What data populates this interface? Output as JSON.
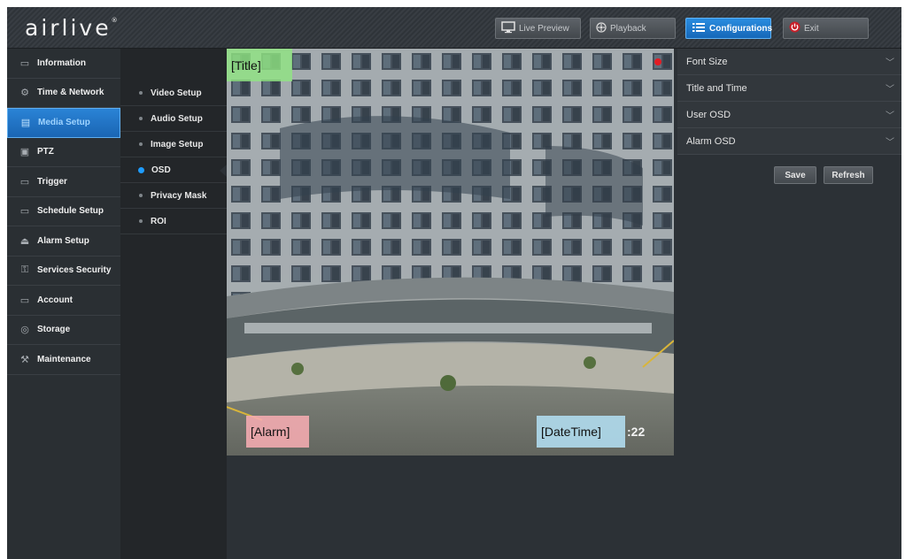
{
  "brand": {
    "logo_text": "airlive",
    "logo_mark": "®"
  },
  "header": {
    "buttons": [
      {
        "label": "Live Preview",
        "icon": "monitor-icon"
      },
      {
        "label": "Playback",
        "icon": "playback-icon"
      },
      {
        "label": "Configurations",
        "icon": "list-icon",
        "active": true
      },
      {
        "label": "Exit",
        "icon": "power-icon"
      }
    ]
  },
  "sidebar": {
    "items": [
      {
        "label": "Information",
        "icon": "info-icon"
      },
      {
        "label": "Time & Network",
        "icon": "gear-icon"
      },
      {
        "label": "Media Setup",
        "icon": "media-icon",
        "active": true
      },
      {
        "label": "PTZ",
        "icon": "ptz-icon"
      },
      {
        "label": "Trigger",
        "icon": "trigger-icon"
      },
      {
        "label": "Schedule Setup",
        "icon": "schedule-icon"
      },
      {
        "label": "Alarm Setup",
        "icon": "alarm-icon"
      },
      {
        "label": "Services Security",
        "icon": "security-icon"
      },
      {
        "label": "Account",
        "icon": "account-icon"
      },
      {
        "label": "Storage",
        "icon": "storage-icon"
      },
      {
        "label": "Maintenance",
        "icon": "wrench-icon"
      }
    ]
  },
  "subnav": {
    "items": [
      {
        "label": "Video Setup"
      },
      {
        "label": "Audio Setup"
      },
      {
        "label": "Image Setup"
      },
      {
        "label": "OSD",
        "active": true
      },
      {
        "label": "Privacy Mask"
      },
      {
        "label": "ROI"
      }
    ]
  },
  "preview": {
    "osd_title": "[Title]",
    "osd_alarm": "[Alarm]",
    "osd_datetime": "[DateTime]",
    "time_fragment": ":22"
  },
  "settings": {
    "sections": [
      {
        "label": "Font Size"
      },
      {
        "label": "Title and Time"
      },
      {
        "label": "User OSD"
      },
      {
        "label": "Alarm OSD"
      }
    ],
    "save_label": "Save",
    "refresh_label": "Refresh"
  },
  "colors": {
    "accent": "#1e8ae6",
    "osd_title_bg": "#90e682",
    "osd_alarm_bg": "#f6acb2",
    "osd_datetime_bg": "#b0dbee",
    "record_dot": "#e21b23"
  }
}
